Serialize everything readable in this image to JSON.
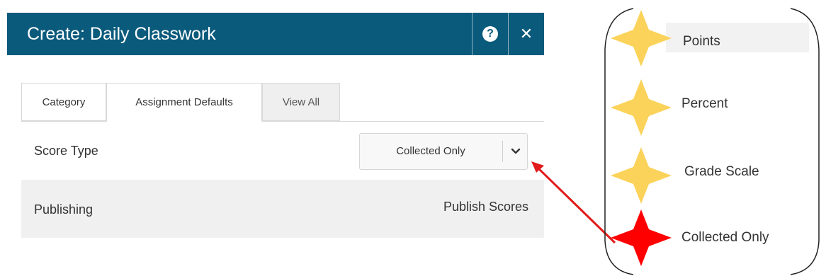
{
  "dialog": {
    "title": "Create: Daily Classwork",
    "help_icon": "question-circle-icon",
    "close_label": "✕"
  },
  "tabs": [
    {
      "label": "Category",
      "active": false
    },
    {
      "label": "Assignment Defaults",
      "active": true
    },
    {
      "label": "View All",
      "active": false
    }
  ],
  "score_type": {
    "label": "Score Type",
    "selected": "Collected Only",
    "dropdown_icon": "chevron-down-icon"
  },
  "publishing": {
    "label": "Publishing",
    "value": "Publish Scores"
  },
  "callout": {
    "options": [
      {
        "label": "Points",
        "star_color": "#fbd35a"
      },
      {
        "label": "Percent",
        "star_color": "#fbd35a"
      },
      {
        "label": "Grade Scale",
        "star_color": "#fbd35a"
      },
      {
        "label": "Collected Only",
        "star_color": "#ff0000"
      }
    ],
    "arrow_color": "#e11b1b"
  },
  "colors": {
    "header_bg": "#0a5a7c",
    "row_bg": "#f0f0f0"
  }
}
